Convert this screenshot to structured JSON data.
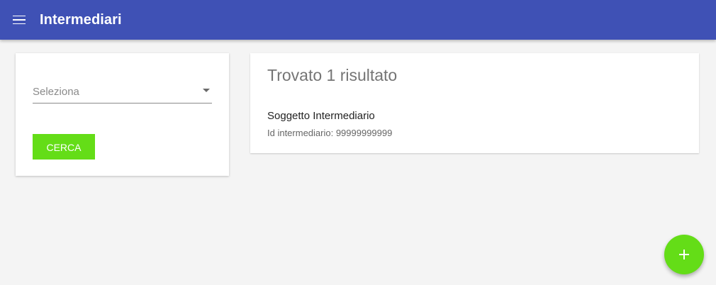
{
  "app_bar": {
    "title": "Intermediari",
    "menu_icon": "menu-icon",
    "color": "#3f51b5"
  },
  "filter": {
    "select_placeholder": "Seleziona",
    "search_button_label": "CERCA",
    "button_color": "#64dd17"
  },
  "results": {
    "heading": "Trovato 1 risultato",
    "items": [
      {
        "name": "Soggetto Intermediario",
        "id_text": "Id intermediario: 99999999999"
      }
    ]
  },
  "fab": {
    "icon": "plus-icon",
    "color": "#64dd17"
  }
}
